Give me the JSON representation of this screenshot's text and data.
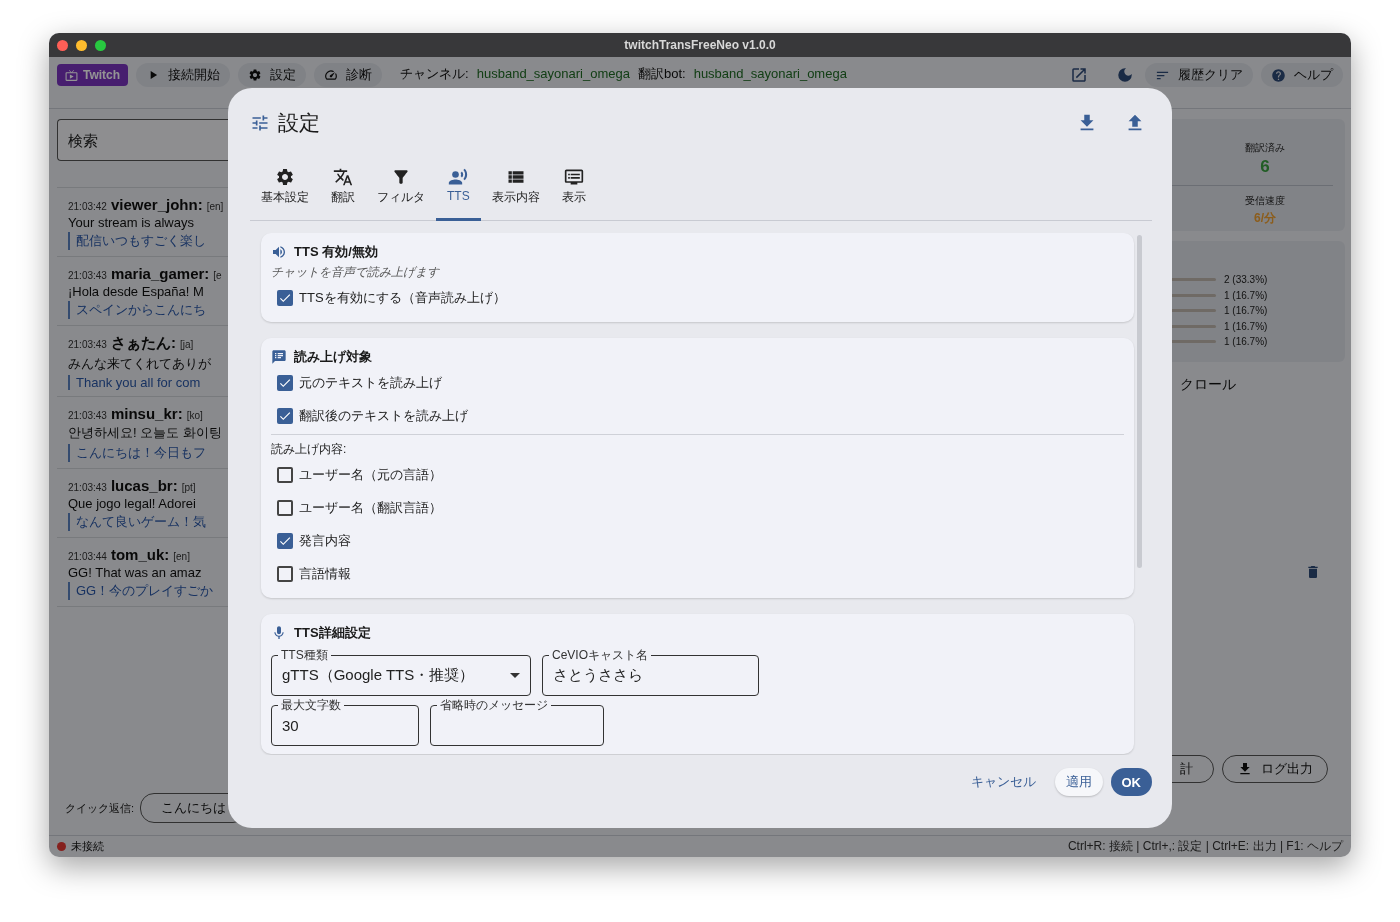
{
  "window": {
    "title": "twitchTransFreeNeo v1.0.0"
  },
  "toolbar": {
    "brand": "Twitch",
    "buttons": [
      {
        "kind": "play",
        "label": "接続開始"
      },
      {
        "kind": "gear",
        "label": "設定"
      },
      {
        "kind": "gauge",
        "label": "診断"
      }
    ],
    "channel_label": "チャンネル:",
    "channel": "husband_sayonari_omega",
    "bot_label": "翻訳bot:",
    "bot": "husband_sayonari_omega",
    "right_buttons": [
      {
        "kind": "clear",
        "label": "履歴クリア"
      },
      {
        "kind": "help",
        "label": "ヘルプ"
      }
    ]
  },
  "search": {
    "placeholder": "検索"
  },
  "messages": [
    {
      "time": "21:03:42",
      "user": "viewer_john:",
      "lang": "[en]",
      "text": "Your stream is always",
      "translation": "配信いつもすごく楽し"
    },
    {
      "time": "21:03:43",
      "user": "maria_gamer:",
      "lang": "[e",
      "text": "¡Hola desde España! M",
      "translation": "スペインからこんにち"
    },
    {
      "time": "21:03:43",
      "user": "さぁたん:",
      "lang": "[ja]",
      "text": "みんな来てくれてありが",
      "translation": "Thank you all for com"
    },
    {
      "time": "21:03:43",
      "user": "minsu_kr:",
      "lang": "[ko]",
      "text": "안녕하세요! 오늘도 화이팅",
      "translation": "こんにちは！今日もフ"
    },
    {
      "time": "21:03:43",
      "user": "lucas_br:",
      "lang": "[pt]",
      "text": "Que jogo legal! Adorei",
      "translation": "なんて良いゲーム！気"
    },
    {
      "time": "21:03:44",
      "user": "tom_uk:",
      "lang": "[en]",
      "text": "GG! That was an amaz",
      "translation": "GG！今のプレイすごか"
    }
  ],
  "quick_reply": {
    "label": "クイック返信:",
    "chips": [
      "こんにちは"
    ]
  },
  "stats": [
    {
      "kind": "translated",
      "label": "翻訳済み",
      "value": "6"
    },
    {
      "kind": "rate",
      "label": "受信速度",
      "value": "6/分"
    }
  ],
  "language_counts": [
    "2 (33.3%)",
    "1 (16.7%)",
    "1 (16.7%)",
    "1 (16.7%)",
    "1 (16.7%)"
  ],
  "autoscroll_label": "クロール",
  "side_buttons": [
    {
      "kind": "plain",
      "label": "計"
    },
    {
      "kind": "download",
      "label": "ログ出力"
    }
  ],
  "status_bar": {
    "state": "未接続",
    "connected": false,
    "shortcuts": "Ctrl+R: 接続 | Ctrl+,: 設定 | Ctrl+E: 出力 | F1: ヘルプ"
  },
  "dialog": {
    "title": "設定",
    "tabs": [
      {
        "kind": "gear",
        "label": "基本設定",
        "selected": false
      },
      {
        "kind": "translate",
        "label": "翻訳",
        "selected": false
      },
      {
        "kind": "filter",
        "label": "フィルタ",
        "selected": false
      },
      {
        "kind": "voice",
        "label": "TTS",
        "selected": true
      },
      {
        "kind": "list",
        "label": "表示内容",
        "selected": false
      },
      {
        "kind": "monitor",
        "label": "表示",
        "selected": false
      }
    ],
    "sections": [
      {
        "kind": "speaker",
        "title": "TTS 有効/無効",
        "subtitle": "チャットを音声で読み上げます",
        "items": [
          {
            "kind": "check",
            "label": "TTSを有効にする（音声読み上げ）",
            "checked": true
          }
        ]
      },
      {
        "kind": "notes",
        "title": "読み上げ対象",
        "items": [
          {
            "kind": "check",
            "label": "元のテキストを読み上げ",
            "checked": true
          },
          {
            "kind": "check",
            "label": "翻訳後のテキストを読み上げ",
            "checked": true
          },
          {
            "kind": "divider"
          },
          {
            "kind": "caption",
            "label": "読み上げ内容:"
          },
          {
            "kind": "check",
            "label": "ユーザー名（元の言語）",
            "checked": false
          },
          {
            "kind": "check",
            "label": "ユーザー名（翻訳言語）",
            "checked": false
          },
          {
            "kind": "check",
            "label": "発言内容",
            "checked": true
          },
          {
            "kind": "check",
            "label": "言語情報",
            "checked": false
          }
        ]
      },
      {
        "kind": "mic",
        "title": "TTS詳細設定",
        "fields": [
          [
            {
              "kind": "select",
              "label": "TTS種類",
              "value": "gTTS（Google TTS・推奨）"
            },
            {
              "kind": "text",
              "label": "CeVIOキャスト名",
              "value": "さとうささら"
            }
          ],
          [
            {
              "kind": "text",
              "label": "最大文字数",
              "value": "30"
            },
            {
              "kind": "text",
              "label": "省略時のメッセージ"
            }
          ]
        ]
      }
    ],
    "buttons": [
      {
        "kind": "text",
        "label": "キャンセル"
      },
      {
        "kind": "soft",
        "label": "適用"
      },
      {
        "kind": "primary",
        "label": "OK"
      }
    ]
  }
}
